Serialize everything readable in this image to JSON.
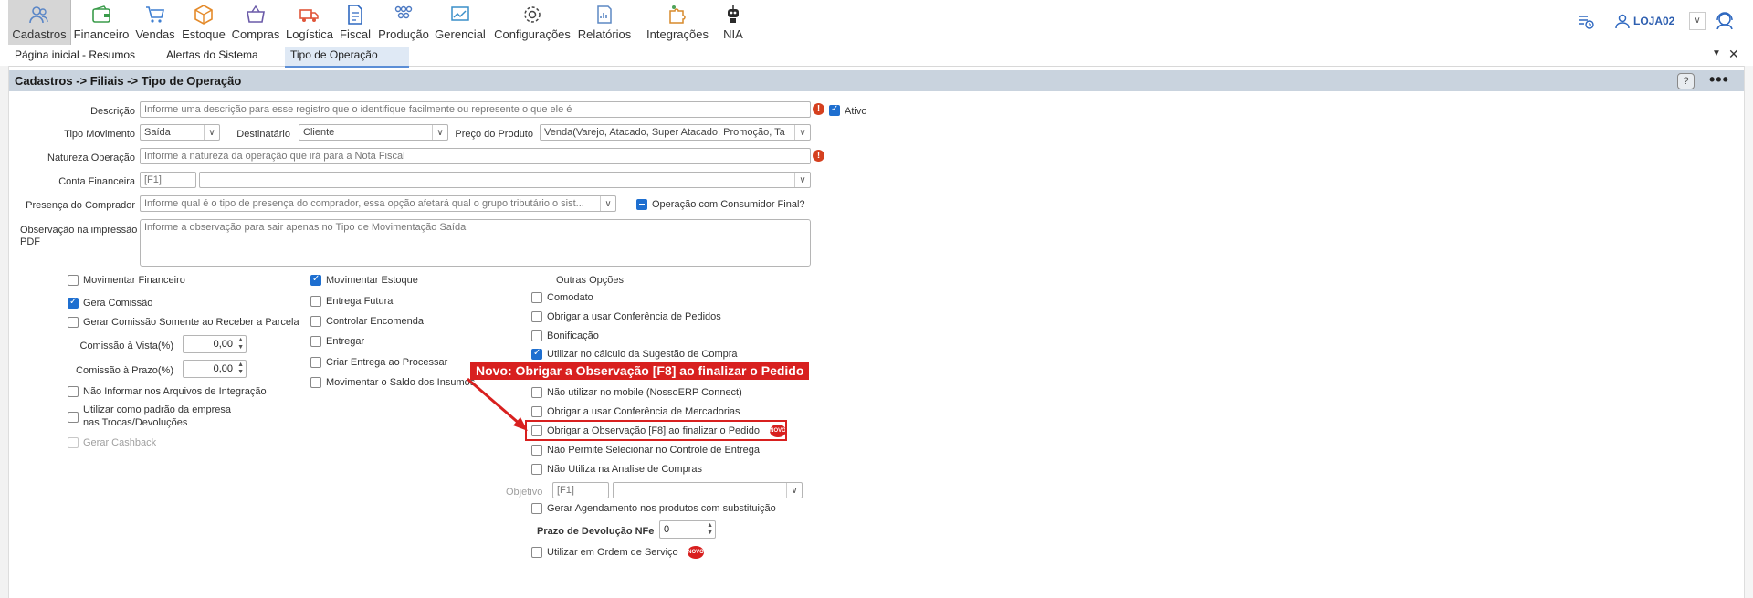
{
  "toolbar": {
    "items": [
      {
        "label": "Cadastros",
        "icon": "users-icon"
      },
      {
        "label": "Financeiro",
        "icon": "wallet-icon"
      },
      {
        "label": "Vendas",
        "icon": "cart-icon"
      },
      {
        "label": "Estoque",
        "icon": "box-icon"
      },
      {
        "label": "Compras",
        "icon": "basket-icon"
      },
      {
        "label": "Logística",
        "icon": "truck-icon"
      },
      {
        "label": "Fiscal",
        "icon": "document-icon"
      },
      {
        "label": "Produção",
        "icon": "factory-icon"
      },
      {
        "label": "Gerencial",
        "icon": "chart-icon"
      },
      {
        "label": "Configurações",
        "icon": "gear-icon"
      },
      {
        "label": "Relatórios",
        "icon": "report-icon"
      },
      {
        "label": "Integrações",
        "icon": "puzzle-icon"
      },
      {
        "label": "NIA",
        "icon": "robot-icon"
      }
    ],
    "user": "LOJA02"
  },
  "tabs": [
    "Página inicial - Resumos",
    "Alertas do Sistema",
    "Tipo de Operação"
  ],
  "breadcrumb": "Cadastros -> Filiais -> Tipo de Operação",
  "form": {
    "descricao_label": "Descrição",
    "descricao_placeholder": "Informe uma descrição para esse registro que o identifique facilmente ou represente o que ele é",
    "ativo_label": "Ativo",
    "tipo_mov_label": "Tipo Movimento",
    "tipo_mov_value": "Saída",
    "destinatario_label": "Destinatário",
    "destinatario_value": "Cliente",
    "preco_label": "Preço do Produto",
    "preco_value": "Venda(Varejo, Atacado, Super Atacado, Promoção, Ta",
    "natureza_label": "Natureza Operação",
    "natureza_placeholder": "Informe a natureza da operação que irá para a Nota Fiscal",
    "conta_label": "Conta Financeira",
    "conta_code": "[F1]",
    "presenca_label": "Presença do Comprador",
    "presenca_placeholder": "Informe qual é o tipo de presença do comprador, essa opção afetará qual o grupo tributário o sist...",
    "consumidor_label": "Operação com Consumidor Final?",
    "obs_label_1": "Observação na impressão",
    "obs_label_2": "PDF",
    "obs_placeholder": "Informe a observação para sair apenas no Tipo de Movimentação Saída"
  },
  "col1": {
    "movimentar_financeiro": "Movimentar Financeiro",
    "gera_comissao": "Gera Comissão",
    "gerar_comissao_parcela": "Gerar Comissão Somente ao Receber a Parcela",
    "comissao_vista_label": "Comissão à Vista(%)",
    "comissao_vista_value": "0,00",
    "comissao_prazo_label": "Comissão à Prazo(%)",
    "comissao_prazo_value": "0,00",
    "nao_informar": "Não Informar nos Arquivos de Integração",
    "utilizar_padrao_1": "Utilizar como padrão da empresa",
    "utilizar_padrao_2": "nas Trocas/Devoluções",
    "gerar_cashback": "Gerar Cashback"
  },
  "col2": {
    "movimentar_estoque": "Movimentar Estoque",
    "entrega_futura": "Entrega Futura",
    "controlar_encomenda": "Controlar Encomenda",
    "entregar": "Entregar",
    "criar_entrega": "Criar Entrega ao Processar",
    "movimentar_insumos": "Movimentar o Saldo dos Insumos"
  },
  "col3": {
    "header": "Outras Opções",
    "comodato": "Comodato",
    "obrigar_conferencia_pedidos": "Obrigar a usar Conferência de Pedidos",
    "bonificacao": "Bonificação",
    "utilizar_sugestao": "Utilizar no cálculo da Sugestão de Compra",
    "nao_utilizar_mobile": "Não utilizar no mobile (NossoERP Connect)",
    "obrigar_conferencia_mercadorias": "Obrigar a usar Conferência de Mercadorias",
    "obrigar_observacao": "Obrigar a Observação [F8] ao finalizar o Pedido",
    "nao_permite_entrega": "Não Permite Selecionar no Controle de Entrega",
    "nao_utiliza_analise": "Não Utiliza na Analise de Compras",
    "objetivo_label": "Objetivo",
    "objetivo_code": "[F1]",
    "gerar_agendamento": "Gerar Agendamento nos produtos com substituição",
    "prazo_label": "Prazo de Devolução NFe",
    "prazo_value": "0",
    "utilizar_os": "Utilizar em Ordem de Serviço"
  },
  "callout": "Novo: Obrigar a Observação [F8] ao finalizar o Pedido",
  "novo_badge": "NOVO",
  "colors": {
    "accent": "#1e6fd0",
    "callout": "#d8201f",
    "titlebar": "#c9d3de"
  }
}
